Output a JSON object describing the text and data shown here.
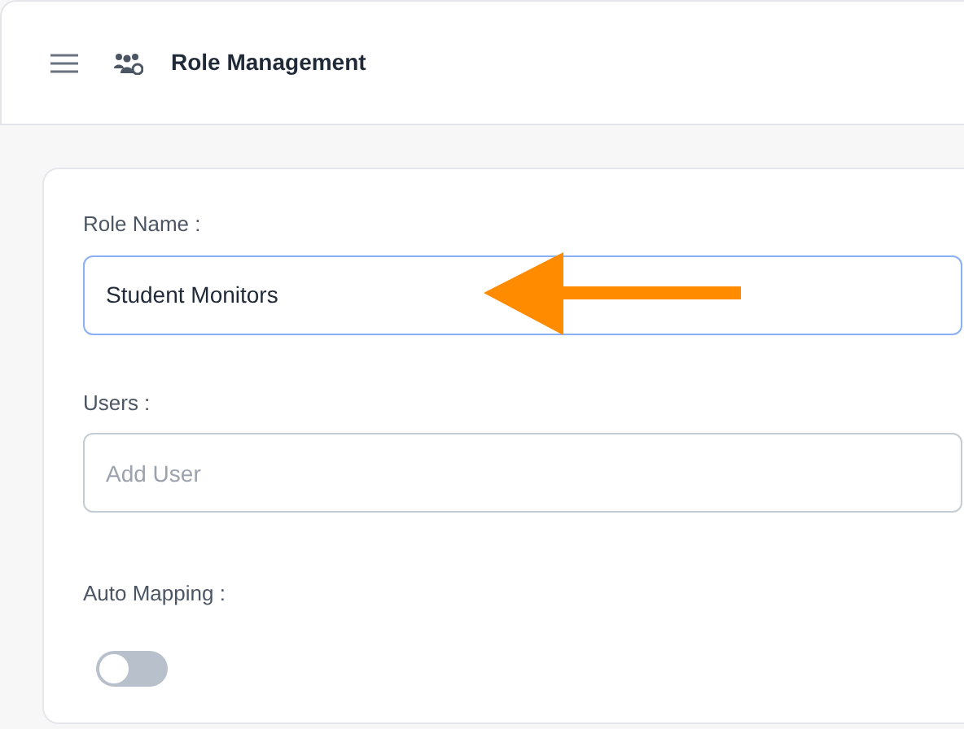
{
  "header": {
    "title": "Role Management"
  },
  "form": {
    "fields": [
      {
        "label": "Role Name :",
        "value": "Student Monitors",
        "focused": true
      },
      {
        "label": "Users :",
        "placeholder": "Add User",
        "focused": false
      }
    ],
    "toggle": {
      "label": "Auto Mapping :",
      "on": false
    }
  }
}
